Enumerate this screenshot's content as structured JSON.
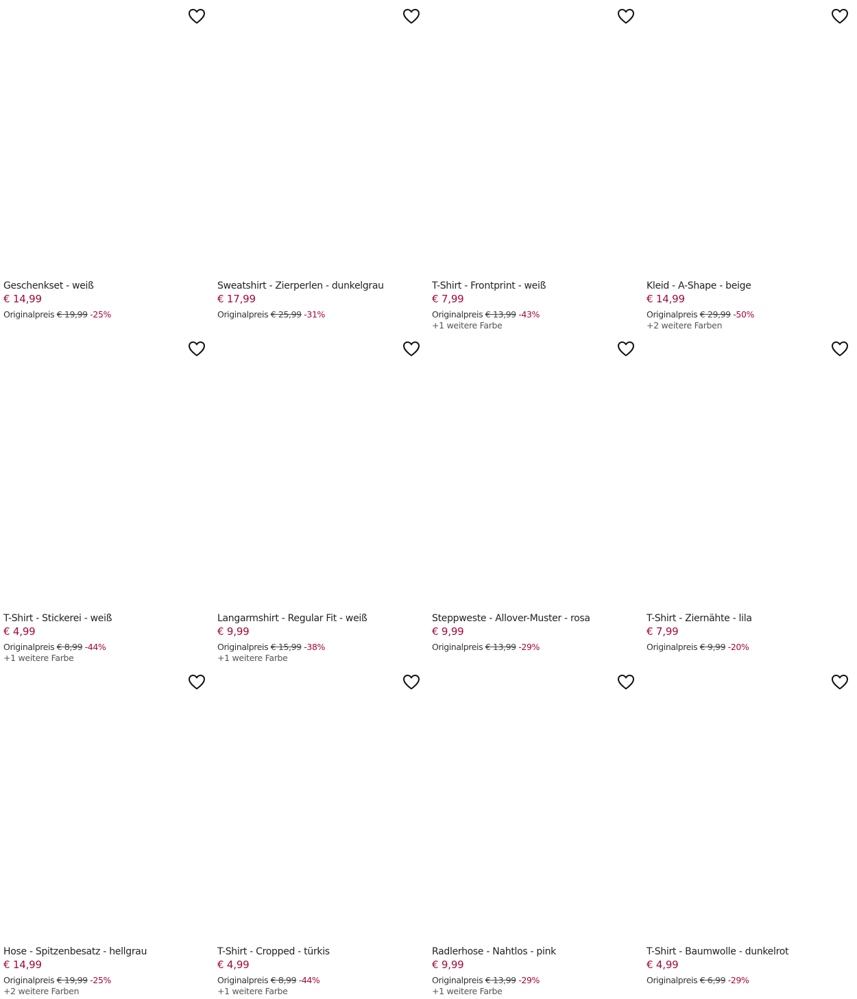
{
  "original_price_label": "Originalpreis",
  "products": [
    {
      "title": "Geschenkset - weiß",
      "price": "€ 14,99",
      "original": "€ 19,99",
      "discount": "-25%",
      "colors": ""
    },
    {
      "title": "Sweatshirt - Zierperlen - dunkelgrau",
      "price": "€ 17,99",
      "original": "€ 25,99",
      "discount": "-31%",
      "colors": ""
    },
    {
      "title": "T-Shirt - Frontprint - weiß",
      "price": "€ 7,99",
      "original": "€ 13,99",
      "discount": "-43%",
      "colors": "+1 weitere Farbe"
    },
    {
      "title": "Kleid - A-Shape - beige",
      "price": "€ 14,99",
      "original": "€ 29,99",
      "discount": "-50%",
      "colors": "+2 weitere Farben"
    },
    {
      "title": "T-Shirt - Stickerei - weiß",
      "price": "€ 4,99",
      "original": "€ 8,99",
      "discount": "-44%",
      "colors": "+1 weitere Farbe"
    },
    {
      "title": "Langarmshirt - Regular Fit - weiß",
      "price": "€ 9,99",
      "original": "€ 15,99",
      "discount": "-38%",
      "colors": "+1 weitere Farbe"
    },
    {
      "title": "Steppweste - Allover-Muster - rosa",
      "price": "€ 9,99",
      "original": "€ 13,99",
      "discount": "-29%",
      "colors": ""
    },
    {
      "title": "T-Shirt - Ziernähte - lila",
      "price": "€ 7,99",
      "original": "€ 9,99",
      "discount": "-20%",
      "colors": ""
    },
    {
      "title": "Hose - Spitzenbesatz - hellgrau",
      "price": "€ 14,99",
      "original": "€ 19,99",
      "discount": "-25%",
      "colors": "+2 weitere Farben"
    },
    {
      "title": "T-Shirt - Cropped - türkis",
      "price": "€ 4,99",
      "original": "€ 8,99",
      "discount": "-44%",
      "colors": "+1 weitere Farbe"
    },
    {
      "title": "Radlerhose - Nahtlos - pink",
      "price": "€ 9,99",
      "original": "€ 13,99",
      "discount": "-29%",
      "colors": "+1 weitere Farbe"
    },
    {
      "title": "T-Shirt - Baumwolle - dunkelrot",
      "price": "€ 4,99",
      "original": "€ 6,99",
      "discount": "-29%",
      "colors": ""
    }
  ],
  "icons": {
    "wishlist": "heart-outline-icon"
  },
  "colors": {
    "sale_price": "#a3083a",
    "text": "#222222"
  }
}
